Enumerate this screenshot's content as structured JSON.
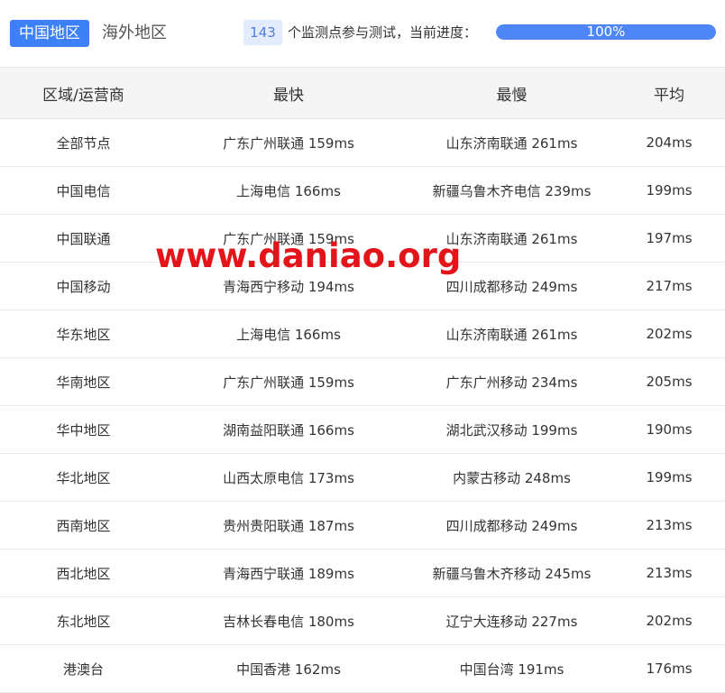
{
  "tabs": [
    {
      "label": "中国地区",
      "active": true
    },
    {
      "label": "海外地区",
      "active": false
    }
  ],
  "progress": {
    "count": "143",
    "text": "个监测点参与测试，当前进度：",
    "percent_label": "100%",
    "value": 1.0
  },
  "table": {
    "headers": [
      "区域/运营商",
      "最快",
      "最慢",
      "平均"
    ],
    "rows": [
      [
        "全部节点",
        "广东广州联通 159ms",
        "山东济南联通 261ms",
        "204ms"
      ],
      [
        "中国电信",
        "上海电信 166ms",
        "新疆乌鲁木齐电信 239ms",
        "199ms"
      ],
      [
        "中国联通",
        "广东广州联通 159ms",
        "山东济南联通 261ms",
        "197ms"
      ],
      [
        "中国移动",
        "青海西宁移动 194ms",
        "四川成都移动 249ms",
        "217ms"
      ],
      [
        "华东地区",
        "上海电信 166ms",
        "山东济南联通 261ms",
        "202ms"
      ],
      [
        "华南地区",
        "广东广州联通 159ms",
        "广东广州移动 234ms",
        "205ms"
      ],
      [
        "华中地区",
        "湖南益阳联通 166ms",
        "湖北武汉移动 199ms",
        "190ms"
      ],
      [
        "华北地区",
        "山西太原电信 173ms",
        "内蒙古移动 248ms",
        "199ms"
      ],
      [
        "西南地区",
        "贵州贵阳联通 187ms",
        "四川成都移动 249ms",
        "213ms"
      ],
      [
        "西北地区",
        "青海西宁联通 189ms",
        "新疆乌鲁木齐移动 245ms",
        "213ms"
      ],
      [
        "东北地区",
        "吉林长春电信 180ms",
        "辽宁大连移动 227ms",
        "202ms"
      ],
      [
        "港澳台",
        "中国香港 162ms",
        "中国台湾 191ms",
        "176ms"
      ]
    ]
  },
  "watermark": "www.daniao.org",
  "colors": {
    "accent": "#3d7ff5",
    "progress_fill": "#4e87f5",
    "badge_bg": "#e3ecfd",
    "watermark": "#e3151a",
    "header_bg": "#f5f5f5"
  }
}
